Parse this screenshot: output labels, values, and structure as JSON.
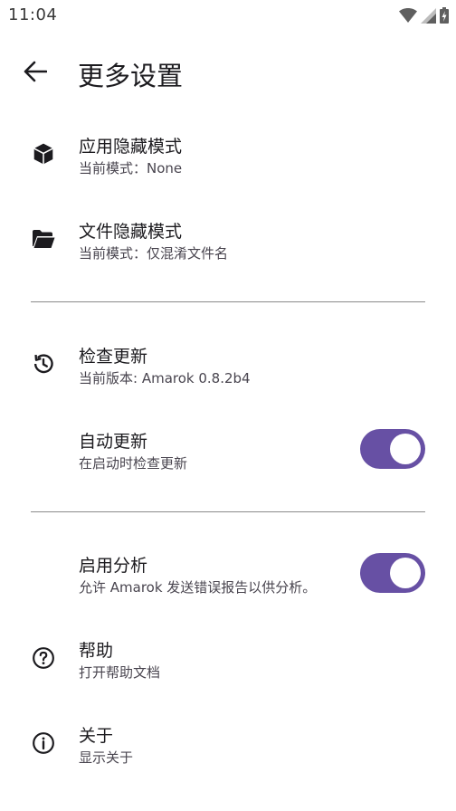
{
  "status_bar": {
    "time": "11:04",
    "icons": [
      "wifi-icon",
      "cellular-signal-icon",
      "battery-charging-icon"
    ]
  },
  "app_bar": {
    "back_icon": "arrow-back-icon",
    "title": "更多设置"
  },
  "preferences": {
    "app_hide_mode": {
      "icon": "cube-icon",
      "title": "应用隐藏模式",
      "summary": "当前模式：None"
    },
    "file_hide_mode": {
      "icon": "folder-open-icon",
      "title": "文件隐藏模式",
      "summary": "当前模式：仅混淆文件名"
    },
    "check_update": {
      "icon": "history-icon",
      "title": "检查更新",
      "summary": "当前版本: Amarok 0.8.2b4"
    },
    "auto_update": {
      "title": "自动更新",
      "summary": "在启动时检查更新",
      "enabled": true
    },
    "analytics": {
      "title": "启用分析",
      "summary": "允许 Amarok 发送错误报告以供分析。",
      "enabled": true
    },
    "help": {
      "icon": "help-circle-icon",
      "title": "帮助",
      "summary": "打开帮助文档"
    },
    "about": {
      "icon": "info-circle-icon",
      "title": "关于",
      "summary": "显示关于"
    }
  },
  "colors": {
    "switch_track": "#6750a4",
    "switch_thumb": "#ffffff",
    "title_text": "#1c1b1f",
    "summary_text": "#49454f",
    "divider": "#8a8a8a"
  }
}
